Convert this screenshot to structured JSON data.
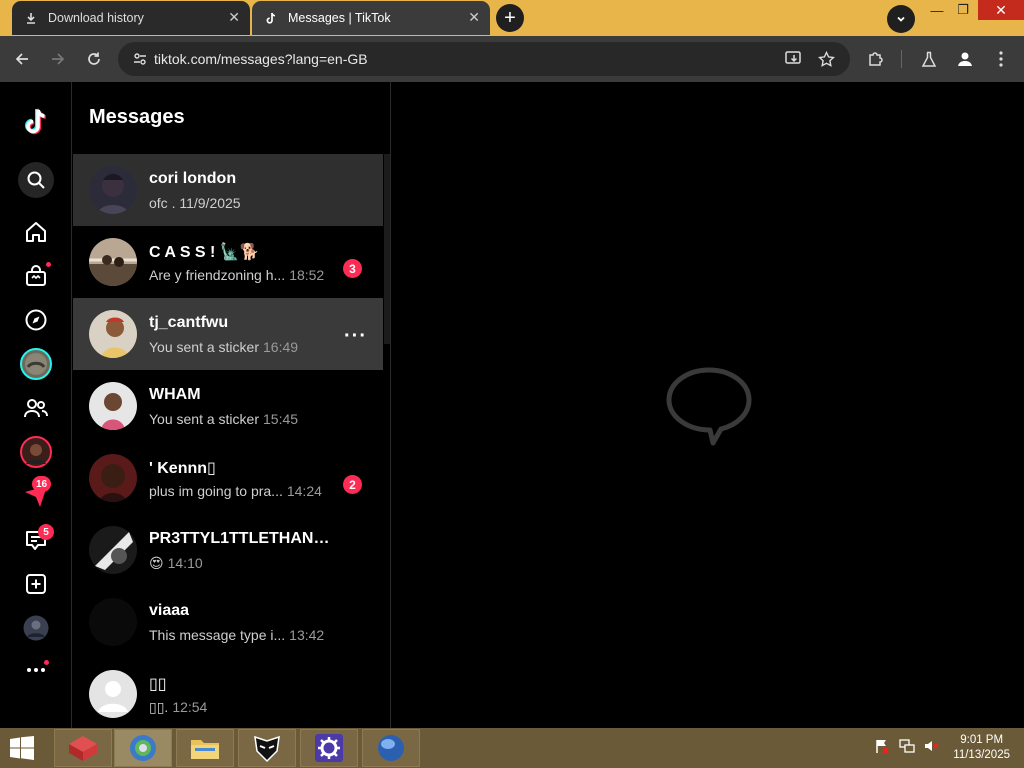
{
  "browser": {
    "tabs": [
      {
        "title": "Download history",
        "icon": "download-icon",
        "active": false
      },
      {
        "title": "Messages | TikTok",
        "icon": "tiktok-icon",
        "active": true
      }
    ],
    "url": "tiktok.com/messages?lang=en-GB",
    "accent_color": "#e7b54a"
  },
  "rail": {
    "items": [
      {
        "name": "tiktok-logo",
        "icon": "tiktok-logo-icon"
      },
      {
        "name": "search",
        "icon": "search-icon"
      },
      {
        "name": "home",
        "icon": "home-icon"
      },
      {
        "name": "shop",
        "icon": "shopping-bag-icon"
      },
      {
        "name": "explore",
        "icon": "compass-icon"
      },
      {
        "name": "live",
        "icon": "live-avatar-icon"
      },
      {
        "name": "following",
        "icon": "friends-icon"
      },
      {
        "name": "friend",
        "icon": "avatar-icon"
      },
      {
        "name": "activity",
        "icon": "send-icon",
        "badge": "16"
      },
      {
        "name": "messages",
        "icon": "inbox-icon",
        "badge": "5"
      },
      {
        "name": "upload",
        "icon": "plus-square-icon"
      },
      {
        "name": "profile",
        "icon": "profile-avatar-icon"
      },
      {
        "name": "more",
        "icon": "more-dots-icon"
      }
    ]
  },
  "messages": {
    "title": "Messages",
    "conversations": [
      {
        "name": "cori london",
        "preview": "ofc . 11/9/2025",
        "time": "",
        "badge": "",
        "selected": true,
        "hover": false
      },
      {
        "name": "C A S S ! 🗽🐕",
        "preview": "Are y friendzoning h...",
        "time": "18:52",
        "badge": "3",
        "selected": false,
        "hover": false
      },
      {
        "name": "tj_cantfwu",
        "preview": "You sent a sticker",
        "time": "16:49",
        "badge": "",
        "selected": false,
        "hover": true
      },
      {
        "name": "WHAM",
        "preview": "You sent a sticker",
        "time": "15:45",
        "badge": "",
        "selected": false,
        "hover": false
      },
      {
        "name": "' Kennn▯",
        "preview": "plus im going to pra...",
        "time": "14:24",
        "badge": "2",
        "selected": false,
        "hover": false
      },
      {
        "name": "PR3TTYL1TTLETHANG...",
        "preview": "😍",
        "time": "14:10",
        "badge": "",
        "selected": false,
        "hover": false
      },
      {
        "name": "viaaa",
        "preview": "This message type i...",
        "time": "13:42",
        "badge": "",
        "selected": false,
        "hover": false
      },
      {
        "name": "▯▯",
        "preview": "▯▯.",
        "time": "12:54",
        "badge": "",
        "selected": false,
        "hover": false
      }
    ]
  },
  "taskbar": {
    "clock_time": "9:01 PM",
    "clock_date": "11/13/2025"
  }
}
